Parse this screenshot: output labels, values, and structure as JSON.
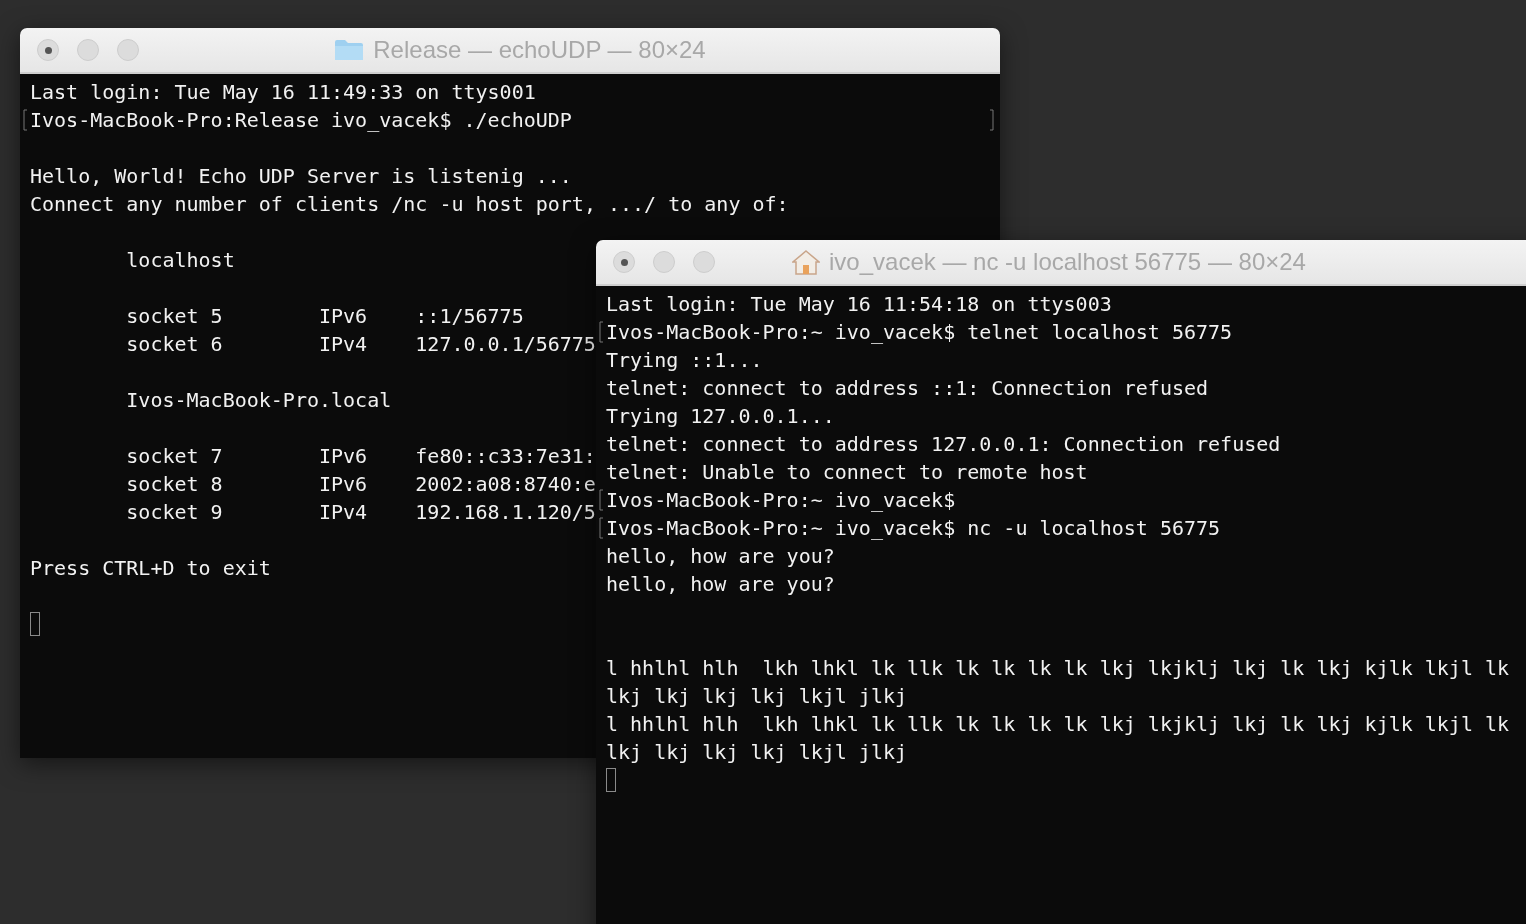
{
  "windows": [
    {
      "title": "Release — echoUDP — 80×24",
      "lines": [
        {
          "kind": "text",
          "text": "Last login: Tue May 16 11:49:33 on ttys001"
        },
        {
          "kind": "prompt",
          "text": "Ivos-MacBook-Pro:Release ivo_vacek$ ./echoUDP",
          "marked": true
        },
        {
          "kind": "blank"
        },
        {
          "kind": "text",
          "text": "Hello, World! Echo UDP Server is listenig ..."
        },
        {
          "kind": "text",
          "text": "Connect any number of clients /nc -u host port, .../ to any of:"
        },
        {
          "kind": "blank"
        },
        {
          "kind": "host",
          "text": "localhost"
        },
        {
          "kind": "blank"
        },
        {
          "kind": "socket",
          "cells": [
            "socket 5",
            "IPv6",
            "::1/56775"
          ]
        },
        {
          "kind": "socket",
          "cells": [
            "socket 6",
            "IPv4",
            "127.0.0.1/56775"
          ]
        },
        {
          "kind": "blank"
        },
        {
          "kind": "host",
          "text": "Ivos-MacBook-Pro.local"
        },
        {
          "kind": "blank"
        },
        {
          "kind": "socket",
          "cells": [
            "socket 7",
            "IPv6",
            "fe80::c33:7e31:"
          ]
        },
        {
          "kind": "socket",
          "cells": [
            "socket 8",
            "IPv6",
            "2002:a08:8740:e"
          ]
        },
        {
          "kind": "socket",
          "cells": [
            "socket 9",
            "IPv4",
            "192.168.1.120/5"
          ]
        },
        {
          "kind": "blank"
        },
        {
          "kind": "text",
          "text": "Press CTRL+D to exit"
        },
        {
          "kind": "blank"
        },
        {
          "kind": "cursor"
        }
      ]
    },
    {
      "title": "ivo_vacek — nc -u localhost 56775 — 80×24",
      "lines": [
        {
          "kind": "text",
          "text": "Last login: Tue May 16 11:54:18 on ttys003"
        },
        {
          "kind": "prompt",
          "text": "Ivos-MacBook-Pro:~ ivo_vacek$ telnet localhost 56775",
          "marked": true
        },
        {
          "kind": "text",
          "text": "Trying ::1..."
        },
        {
          "kind": "text",
          "text": "telnet: connect to address ::1: Connection refused"
        },
        {
          "kind": "text",
          "text": "Trying 127.0.0.1..."
        },
        {
          "kind": "text",
          "text": "telnet: connect to address 127.0.0.1: Connection refused"
        },
        {
          "kind": "text",
          "text": "telnet: Unable to connect to remote host"
        },
        {
          "kind": "prompt",
          "text": "Ivos-MacBook-Pro:~ ivo_vacek$",
          "marked": true
        },
        {
          "kind": "prompt",
          "text": "Ivos-MacBook-Pro:~ ivo_vacek$ nc -u localhost 56775",
          "marked": true
        },
        {
          "kind": "text",
          "text": "hello, how are you?"
        },
        {
          "kind": "text",
          "text": "hello, how are you?"
        },
        {
          "kind": "blank"
        },
        {
          "kind": "blank"
        },
        {
          "kind": "text",
          "text": "l hhlhl hlh  lkh lhkl lk llk lk lk lk lk lkj lkjklj lkj lk lkj kjlk lkjl lk"
        },
        {
          "kind": "text",
          "text": "lkj lkj lkj lkj lkjl jlkj"
        },
        {
          "kind": "text",
          "text": "l hhlhl hlh  lkh lhkl lk llk lk lk lk lk lkj lkjklj lkj lk lkj kjlk lkjl lk"
        },
        {
          "kind": "text",
          "text": "lkj lkj lkj lkj lkjl jlkj"
        },
        {
          "kind": "cursor"
        }
      ]
    }
  ]
}
